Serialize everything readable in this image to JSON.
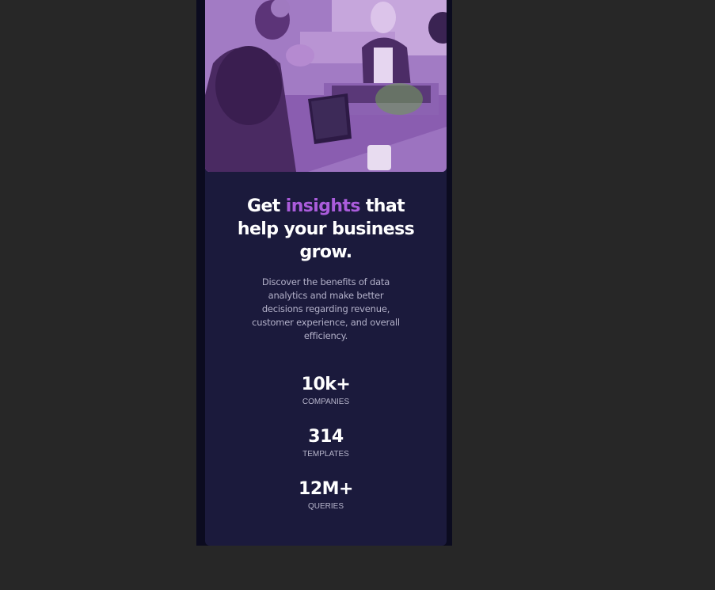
{
  "hero": {
    "image": "people-working-with-laptops-photo",
    "tint_color": "#aa5cdb"
  },
  "headline": {
    "before": "Get ",
    "accent": "insights",
    "after_line1": " that",
    "line2": "help your business",
    "line3": "grow."
  },
  "description": "Discover the benefits of data analytics and make better decisions regarding revenue, customer experience, and overall efficiency.",
  "stats": [
    {
      "value": "10k+",
      "label": "COMPANIES"
    },
    {
      "value": "314",
      "label": "TEMPLATES"
    },
    {
      "value": "12M+",
      "label": "QUERIES"
    }
  ],
  "colors": {
    "background": "#272727",
    "page": "#0b0b1f",
    "card": "#1b1a3c",
    "accent": "#aa5cdb"
  }
}
